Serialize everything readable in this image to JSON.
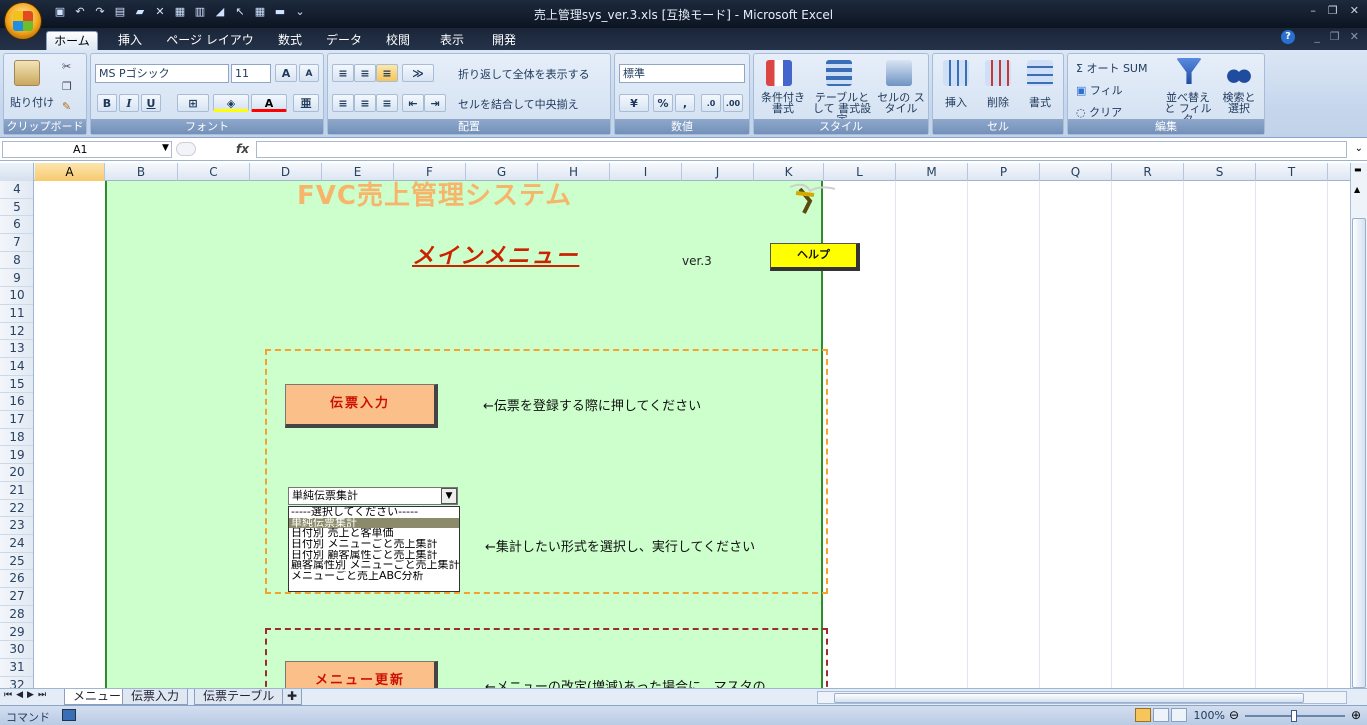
{
  "window": {
    "title": "売上管理sys_ver.3.xls  [互換モード] - Microsoft Excel"
  },
  "ribbon_tabs": [
    "ホーム",
    "挿入",
    "ページ レイアウト",
    "数式",
    "データ",
    "校閲",
    "表示",
    "開発"
  ],
  "clipboard": {
    "paste": "貼り付け",
    "label": "クリップボード"
  },
  "font": {
    "name": "MS Pゴシック",
    "size": "11",
    "label": "フォント",
    "bold": "B",
    "italic": "I",
    "underline": "U"
  },
  "alignment": {
    "wrap": "折り返して全体を表示する",
    "merge": "セルを結合して中央揃え",
    "label": "配置"
  },
  "number": {
    "format": "標準",
    "percent": "%",
    "comma": ",",
    "label": "数値"
  },
  "styles": {
    "conditional": "条件付き 書式",
    "table": "テーブルとして 書式設定",
    "cell": "セルの スタイル",
    "label": "スタイル"
  },
  "cells": {
    "insert": "挿入",
    "delete": "削除",
    "format": "書式",
    "label": "セル"
  },
  "editing": {
    "autosum": "オート SUM",
    "fill": "フィル",
    "clear": "クリア",
    "sort": "並べ替えと フィルタ",
    "find": "検索と 選択",
    "label": "編集"
  },
  "formula_bar": {
    "name_box": "A1",
    "fx": "fx",
    "content": ""
  },
  "columns": [
    "A",
    "B",
    "C",
    "D",
    "E",
    "F",
    "G",
    "H",
    "I",
    "J",
    "K",
    "L",
    "M",
    "P",
    "Q",
    "R",
    "S",
    "T"
  ],
  "rows": [
    "4",
    "5",
    "6",
    "7",
    "8",
    "9",
    "10",
    "11",
    "12",
    "13",
    "14",
    "15",
    "16",
    "17",
    "18",
    "19",
    "20",
    "21",
    "22",
    "23",
    "24",
    "25",
    "26",
    "27",
    "28",
    "29",
    "30",
    "31",
    "32"
  ],
  "sheet": {
    "system_title": "FVC売上管理システム",
    "main_menu": "メインメニュー",
    "version": "ver.3",
    "help_button": "ヘルプ",
    "denpyo_button": "伝票入力",
    "denpyo_note": "←伝票を登録する際に押してください",
    "combo_value": "単純伝票集計",
    "combo_options": [
      "-----選択してください-----",
      "単純伝票集計",
      "日付別 売上と客単価",
      "日付別 メニューごと売上集計",
      "日付別 顧客属性ごと売上集計",
      "顧客属性別 メニューごと売上集計",
      "メニューごと売上ABC分析"
    ],
    "combo_selected_index": 1,
    "aggregate_note": "←集計したい形式を選択し、実行してください",
    "menu_update_button": "メニュー更新",
    "menu_update_note": "←メニューの改定(増減)あった場合に、マスタの"
  },
  "sheet_tabs": [
    "メニュー",
    "伝票入力",
    "伝票テーブル"
  ],
  "status": {
    "mode": "コマンド",
    "zoom": "100%"
  }
}
